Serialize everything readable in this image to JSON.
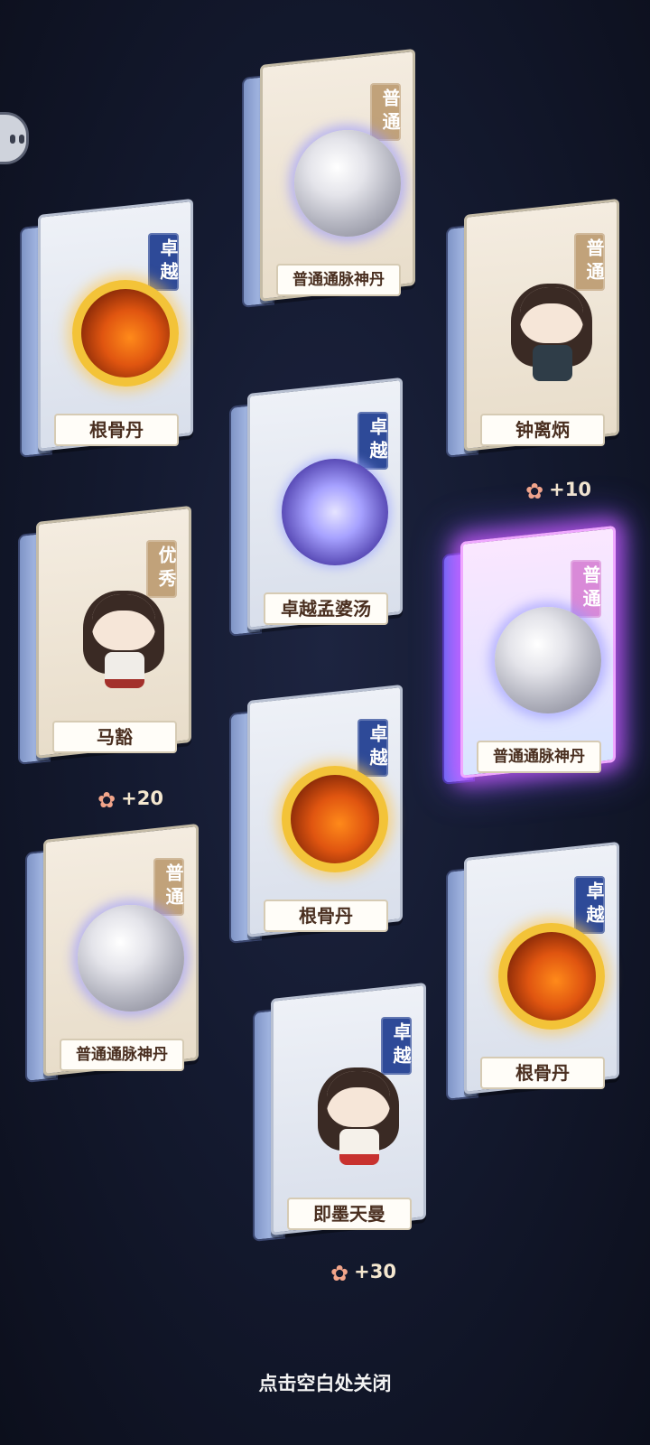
{
  "cards": [
    {
      "rarity": "普通",
      "name": "普通通脉神丹"
    },
    {
      "rarity": "卓越",
      "name": "根骨丹"
    },
    {
      "rarity": "普通",
      "name": "钟离炳"
    },
    {
      "rarity": "卓越",
      "name": "卓越孟婆汤"
    },
    {
      "rarity": "优秀",
      "name": "马豁"
    },
    {
      "rarity": "普通",
      "name": "普通通脉神丹"
    },
    {
      "rarity": "卓越",
      "name": "根骨丹"
    },
    {
      "rarity": "普通",
      "name": "普通通脉神丹"
    },
    {
      "rarity": "卓越",
      "name": "根骨丹"
    },
    {
      "rarity": "卓越",
      "name": "即墨天曼"
    }
  ],
  "bonuses": [
    "+10",
    "+20",
    "+30"
  ],
  "close_hint": "点击空白处关闭",
  "colors": {
    "rarity_excellent": "#2e4a98",
    "rarity_common": "#c1a27a",
    "glow": "#d25aff"
  }
}
